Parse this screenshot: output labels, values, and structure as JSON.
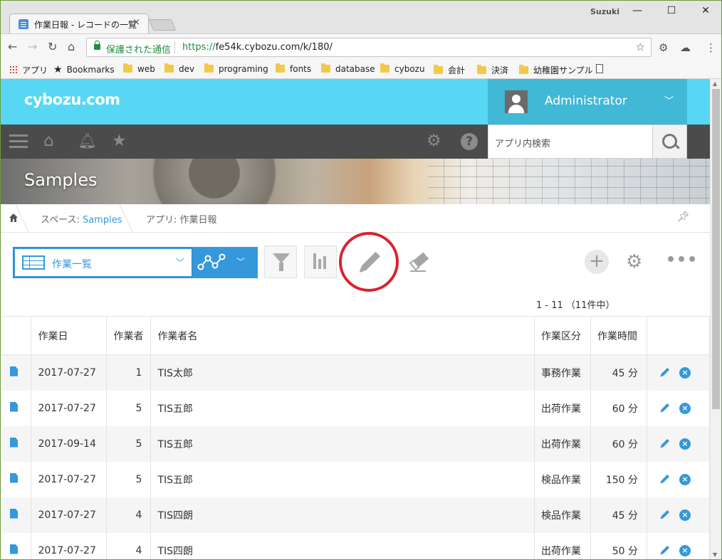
{
  "browser": {
    "tab_title": "作業日報 - レコードの一覧",
    "tab_close": "×",
    "profile_name": "Suzuki",
    "win_minimize": "—",
    "win_maximize": "☐",
    "win_close": "✕",
    "secure_label": "保護された通信",
    "url_proto": "https://",
    "url_rest": "fe54k.cybozu.com/k/180/",
    "bookmarks": {
      "apps": "アプリ",
      "bookmarks": "Bookmarks",
      "items": [
        "web",
        "dev",
        "programing",
        "fonts",
        "database",
        "cybozu",
        "会計",
        "決済",
        "幼稚園サンプル"
      ]
    }
  },
  "header": {
    "logo": "cybozu.com",
    "user_name": "Administrator"
  },
  "nav": {
    "search_placeholder": "アプリ内検索"
  },
  "space": {
    "title": "Samples"
  },
  "breadcrumb": {
    "space_prefix": "スペース: ",
    "space_link": "Samples",
    "app_label": "アプリ: 作業日報"
  },
  "toolbar": {
    "view_name": "作業一覧",
    "record_count": "1 - 11 （11件中）"
  },
  "table": {
    "columns": [
      "作業日",
      "作業者",
      "作業者名",
      "作業区分",
      "作業時間"
    ],
    "rows": [
      {
        "date": "2017-07-27",
        "user": "1",
        "name": "TIS太郎",
        "type": "事務作業",
        "time": "45 分"
      },
      {
        "date": "2017-07-27",
        "user": "5",
        "name": "TIS五郎",
        "type": "出荷作業",
        "time": "60 分"
      },
      {
        "date": "2017-09-14",
        "user": "5",
        "name": "TIS五郎",
        "type": "出荷作業",
        "time": "60 分"
      },
      {
        "date": "2017-07-27",
        "user": "5",
        "name": "TIS五郎",
        "type": "検品作業",
        "time": "150 分"
      },
      {
        "date": "2017-07-27",
        "user": "4",
        "name": "TIS四朗",
        "type": "検品作業",
        "time": "45 分"
      },
      {
        "date": "2017-07-27",
        "user": "4",
        "name": "TIS四朗",
        "type": "出荷作業",
        "time": "50 分"
      }
    ]
  },
  "colors": {
    "header_bg": "#57d7f4",
    "accent": "#3498db",
    "nav_bg": "#4b4b4b",
    "highlight_circle": "#d9232e"
  }
}
